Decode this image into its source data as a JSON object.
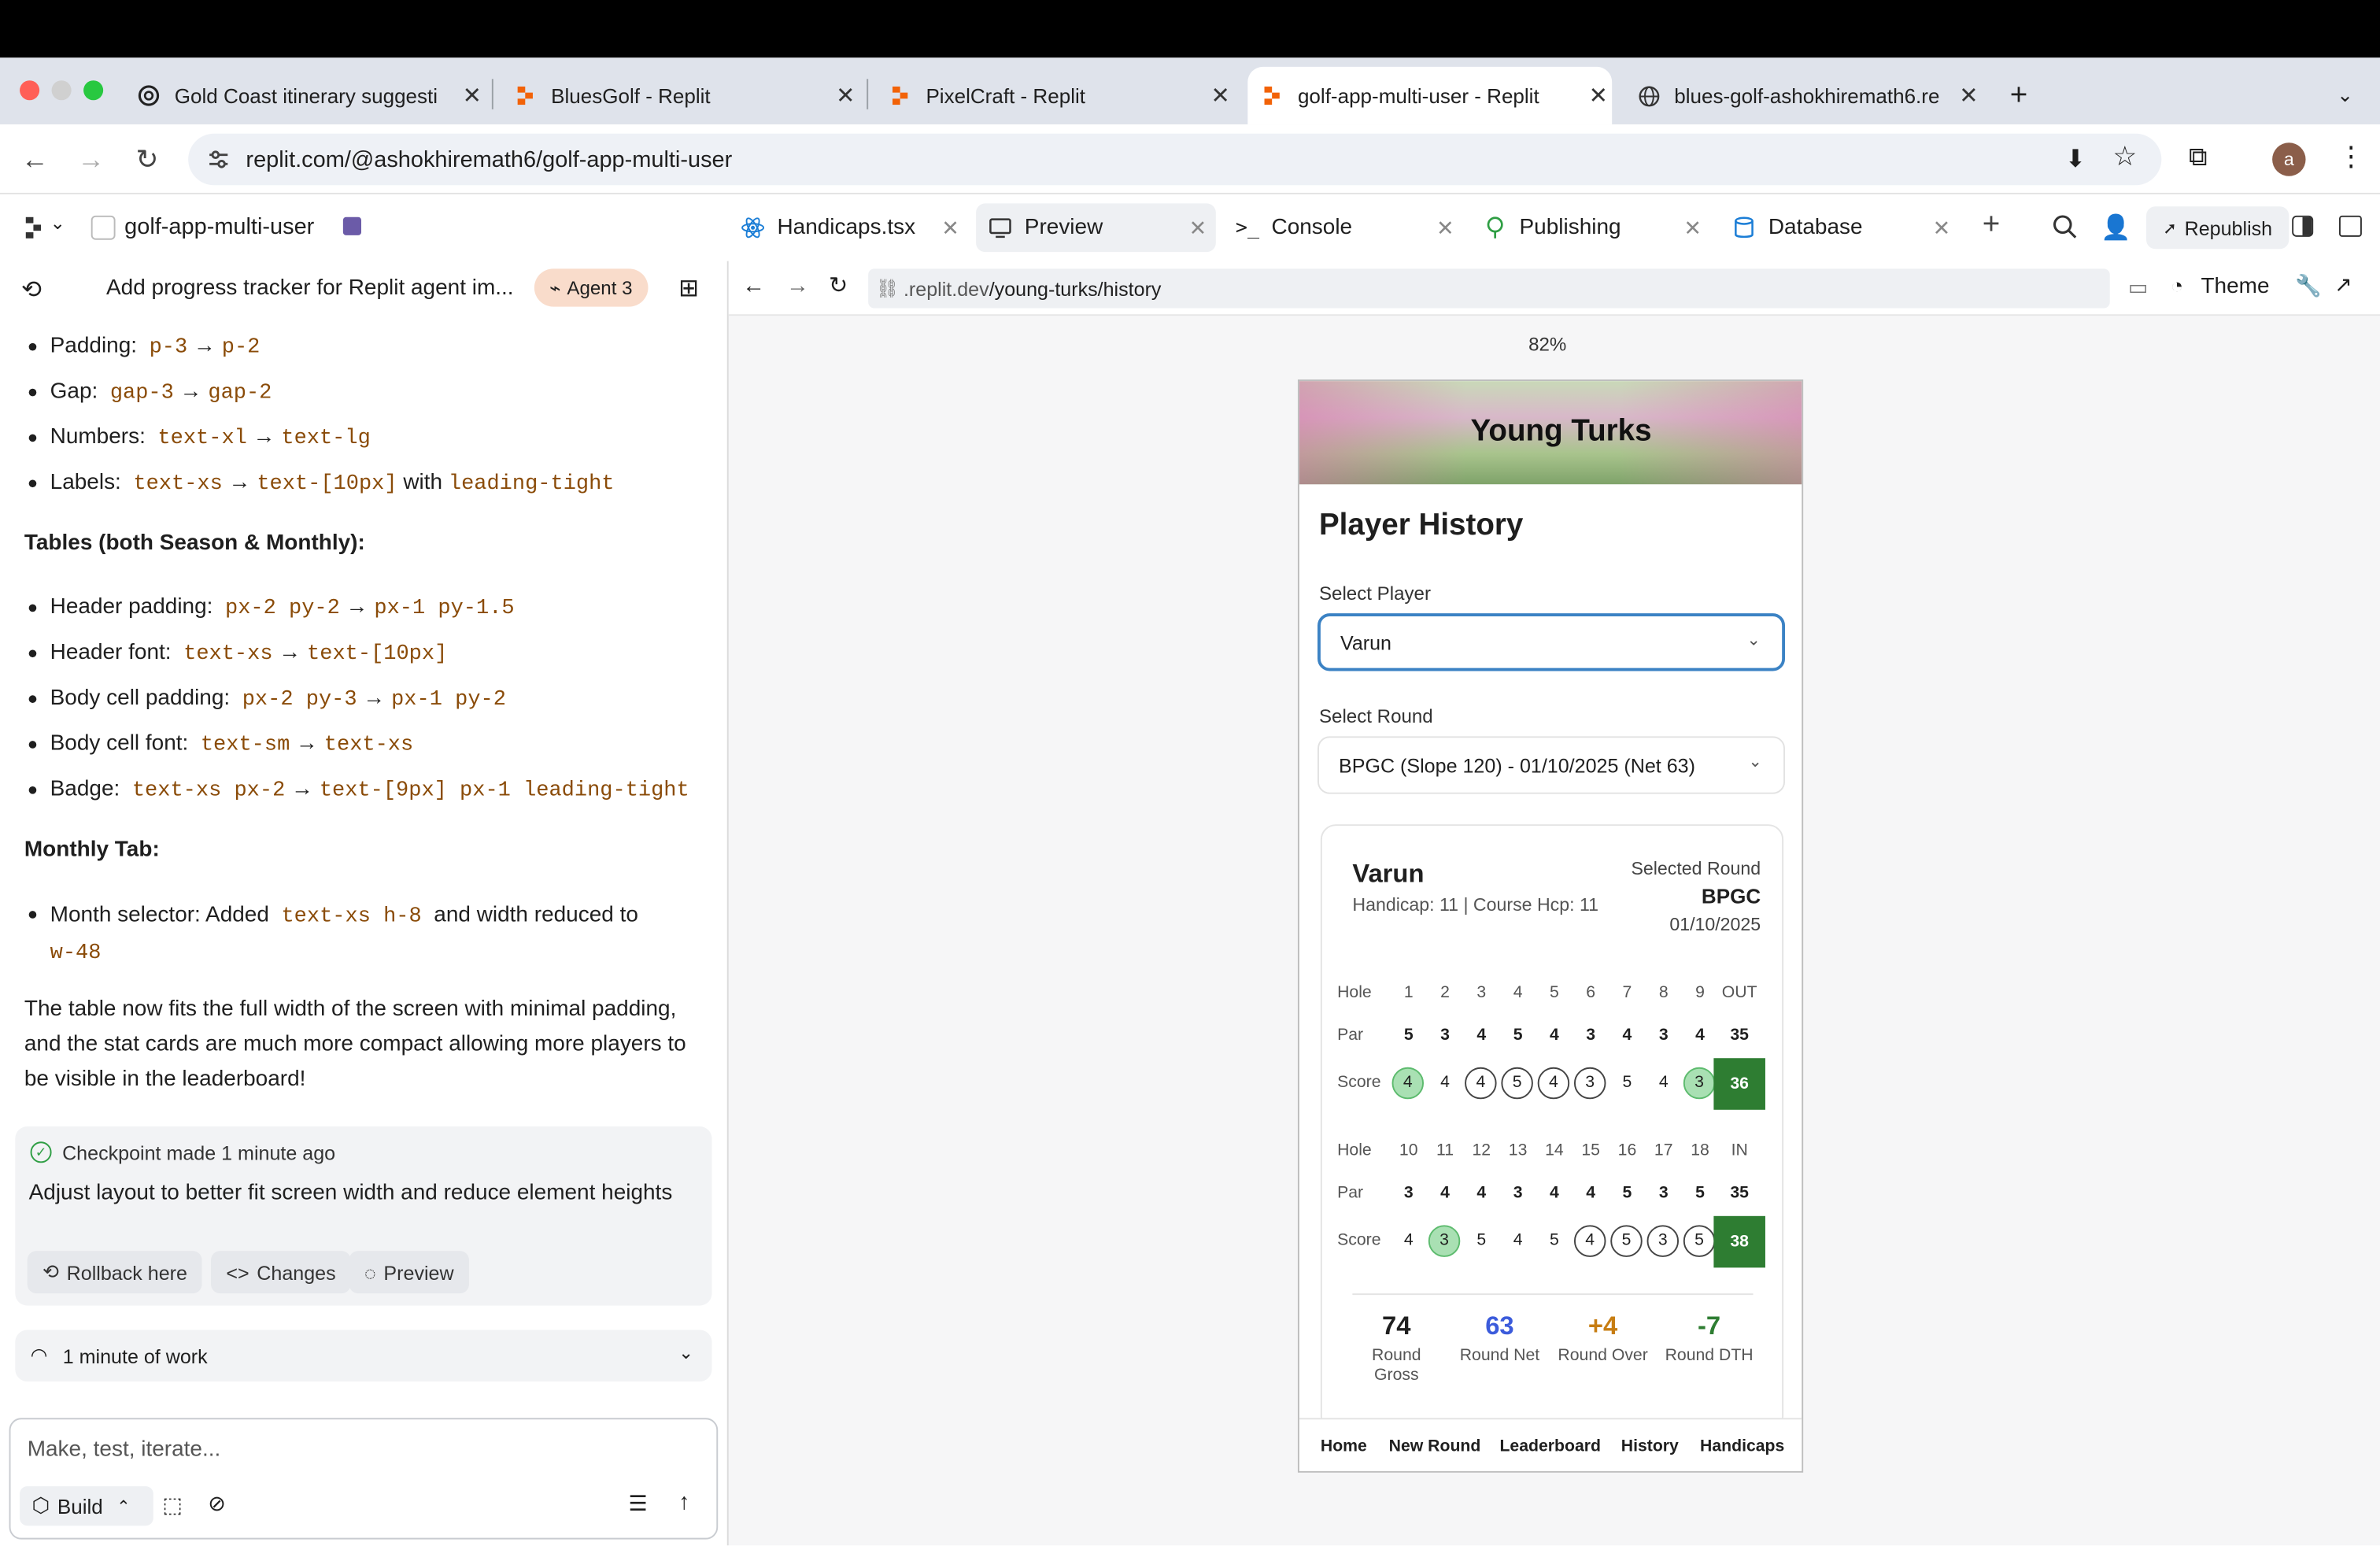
{
  "browser": {
    "tabs": [
      {
        "title": "Gold Coast itinerary suggesti",
        "icon": "openai-icon"
      },
      {
        "title": "BluesGolf - Replit",
        "icon": "replit-icon"
      },
      {
        "title": "PixelCraft - Replit",
        "icon": "replit-icon"
      },
      {
        "title": "golf-app-multi-user - Replit",
        "icon": "replit-icon"
      },
      {
        "title": "blues-golf-ashokhiremath6.re",
        "icon": "globe-icon"
      }
    ],
    "url": "replit.com/@ashokhiremath6/golf-app-multi-user",
    "profile_initial": "a"
  },
  "workspace": {
    "project_name": "golf-app-multi-user",
    "tabs": [
      {
        "label": "Handicaps.tsx"
      },
      {
        "label": "Preview"
      },
      {
        "label": "Console"
      },
      {
        "label": "Publishing"
      },
      {
        "label": "Database"
      }
    ],
    "republish_label": "Republish"
  },
  "agent": {
    "title": "Add progress tracker for Replit agent im...",
    "badge": "Agent 3",
    "list1": [
      {
        "label": "Padding:",
        "from": "p-3",
        "to": "p-2"
      },
      {
        "label": "Gap:",
        "from": "gap-3",
        "to": "gap-2"
      },
      {
        "label": "Numbers:",
        "from": "text-xl",
        "to": "text-lg"
      },
      {
        "label": "Labels:",
        "from": "text-xs",
        "to": "text-[10px]",
        "extra_word": "with",
        "extra_code": "leading-tight"
      }
    ],
    "tables_heading": "Tables (both Season & Monthly):",
    "list2": [
      {
        "label": "Header padding:",
        "from": "px-2 py-2",
        "to": "px-1 py-1.5"
      },
      {
        "label": "Header font:",
        "from": "text-xs",
        "to": "text-[10px]"
      },
      {
        "label": "Body cell padding:",
        "from": "px-2 py-3",
        "to": "px-1 py-2"
      },
      {
        "label": "Body cell font:",
        "from": "text-sm",
        "to": "text-xs"
      },
      {
        "label": "Badge:",
        "from": "text-xs px-2",
        "to": "text-[9px] px-1 leading-tight"
      }
    ],
    "monthly_heading": "Monthly Tab:",
    "monthly_item": {
      "label": "Month selector: Added",
      "code1": "text-xs h-8",
      "mid": "and width reduced to",
      "code2": "w-48"
    },
    "summary": "The table now fits the full width of the screen with minimal padding, and the stat cards are much more compact allowing more players to be visible in the leaderboard!",
    "checkpoint": {
      "status": "Checkpoint made 1 minute ago",
      "message": "Adjust layout to better fit screen width and reduce element heights",
      "rollback": "Rollback here",
      "changes": "Changes",
      "preview": "Preview"
    },
    "work": "1 minute of work",
    "input_placeholder": "Make, test, iterate...",
    "build_label": "Build"
  },
  "preview": {
    "url_prefix": ".replit.dev",
    "url_path": "/young-turks/history",
    "theme_label": "Theme",
    "zoom": "82%"
  },
  "app": {
    "club_name": "Young Turks",
    "page_title": "Player History",
    "select_player_label": "Select Player",
    "selected_player": "Varun",
    "select_round_label": "Select Round",
    "selected_round": "BPGC (Slope 120) - 01/10/2025 (Net 63)",
    "card": {
      "player": "Varun",
      "handicap_line": "Handicap: 11 | Course Hcp: 11",
      "selected_round_label": "Selected Round",
      "course": "BPGC",
      "date": "01/10/2025"
    },
    "front": {
      "hole_label": "Hole",
      "par_label": "Par",
      "score_label": "Score",
      "holes": [
        "1",
        "2",
        "3",
        "4",
        "5",
        "6",
        "7",
        "8",
        "9"
      ],
      "total_label": "OUT",
      "par": [
        "5",
        "3",
        "4",
        "5",
        "4",
        "3",
        "4",
        "3",
        "4"
      ],
      "par_total": "35",
      "score": [
        "4",
        "4",
        "4",
        "5",
        "4",
        "3",
        "5",
        "4",
        "3"
      ],
      "score_style": [
        "green",
        "plain",
        "circle",
        "circle",
        "circle",
        "circle",
        "plain",
        "plain",
        "green"
      ],
      "score_total": "36"
    },
    "back": {
      "hole_label": "Hole",
      "par_label": "Par",
      "score_label": "Score",
      "holes": [
        "10",
        "11",
        "12",
        "13",
        "14",
        "15",
        "16",
        "17",
        "18"
      ],
      "total_label": "IN",
      "par": [
        "3",
        "4",
        "4",
        "3",
        "4",
        "4",
        "5",
        "3",
        "5"
      ],
      "par_total": "35",
      "score": [
        "4",
        "3",
        "5",
        "4",
        "5",
        "4",
        "5",
        "3",
        "5"
      ],
      "score_style": [
        "plain",
        "green",
        "plain",
        "plain",
        "plain",
        "circle",
        "circle",
        "circle",
        "circle"
      ],
      "score_total": "38"
    },
    "stats": [
      {
        "value": "74",
        "label": "Round Gross",
        "color": "#1f1f1f"
      },
      {
        "value": "63",
        "label": "Round Net",
        "color": "#3b5bdb"
      },
      {
        "value": "+4",
        "label": "Round Over",
        "color": "#c77d12"
      },
      {
        "value": "-7",
        "label": "Round DTH",
        "color": "#2e7d32"
      }
    ],
    "nav": [
      "Home",
      "New Round",
      "Leaderboard",
      "History",
      "Handicaps"
    ]
  }
}
